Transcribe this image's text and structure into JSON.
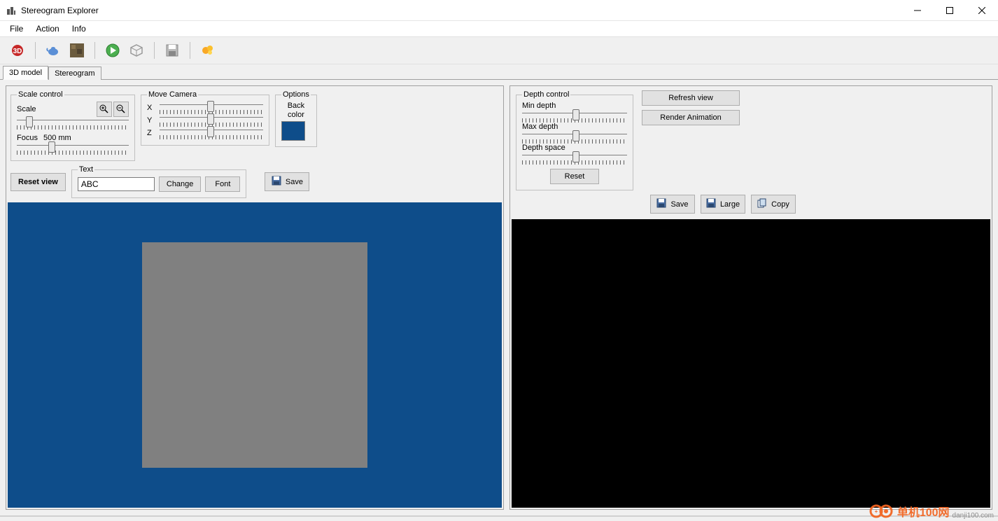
{
  "app": {
    "title": "Stereogram Explorer"
  },
  "menu": {
    "file": "File",
    "action": "Action",
    "info": "Info"
  },
  "toolbar_icons": [
    "3d",
    "teapot",
    "texture",
    "play",
    "cube",
    "save",
    "animate"
  ],
  "tabs": {
    "model": "3D model",
    "stereogram": "Stereogram"
  },
  "left": {
    "scale_control": {
      "legend": "Scale control",
      "scale_label": "Scale",
      "focus_label": "Focus",
      "focus_value": "500 mm"
    },
    "move_camera": {
      "legend": "Move Camera",
      "x": "X",
      "y": "Y",
      "z": "Z"
    },
    "options": {
      "legend": "Options",
      "back_color_label": "Back color",
      "back_color": "#0e4d8a"
    },
    "reset_view": "Reset view",
    "text_group": {
      "legend": "Text",
      "value": "ABC",
      "change": "Change",
      "font": "Font"
    },
    "save_btn": "Save"
  },
  "right": {
    "depth_control": {
      "legend": "Depth control",
      "min_depth": "Min depth",
      "max_depth": "Max depth",
      "depth_space": "Depth space",
      "reset": "Reset"
    },
    "refresh_view": "Refresh view",
    "render_animation": "Render Animation",
    "save": "Save",
    "large": "Large",
    "copy": "Copy"
  },
  "watermark": {
    "text": "单机100网",
    "sub": "danji100.com"
  }
}
